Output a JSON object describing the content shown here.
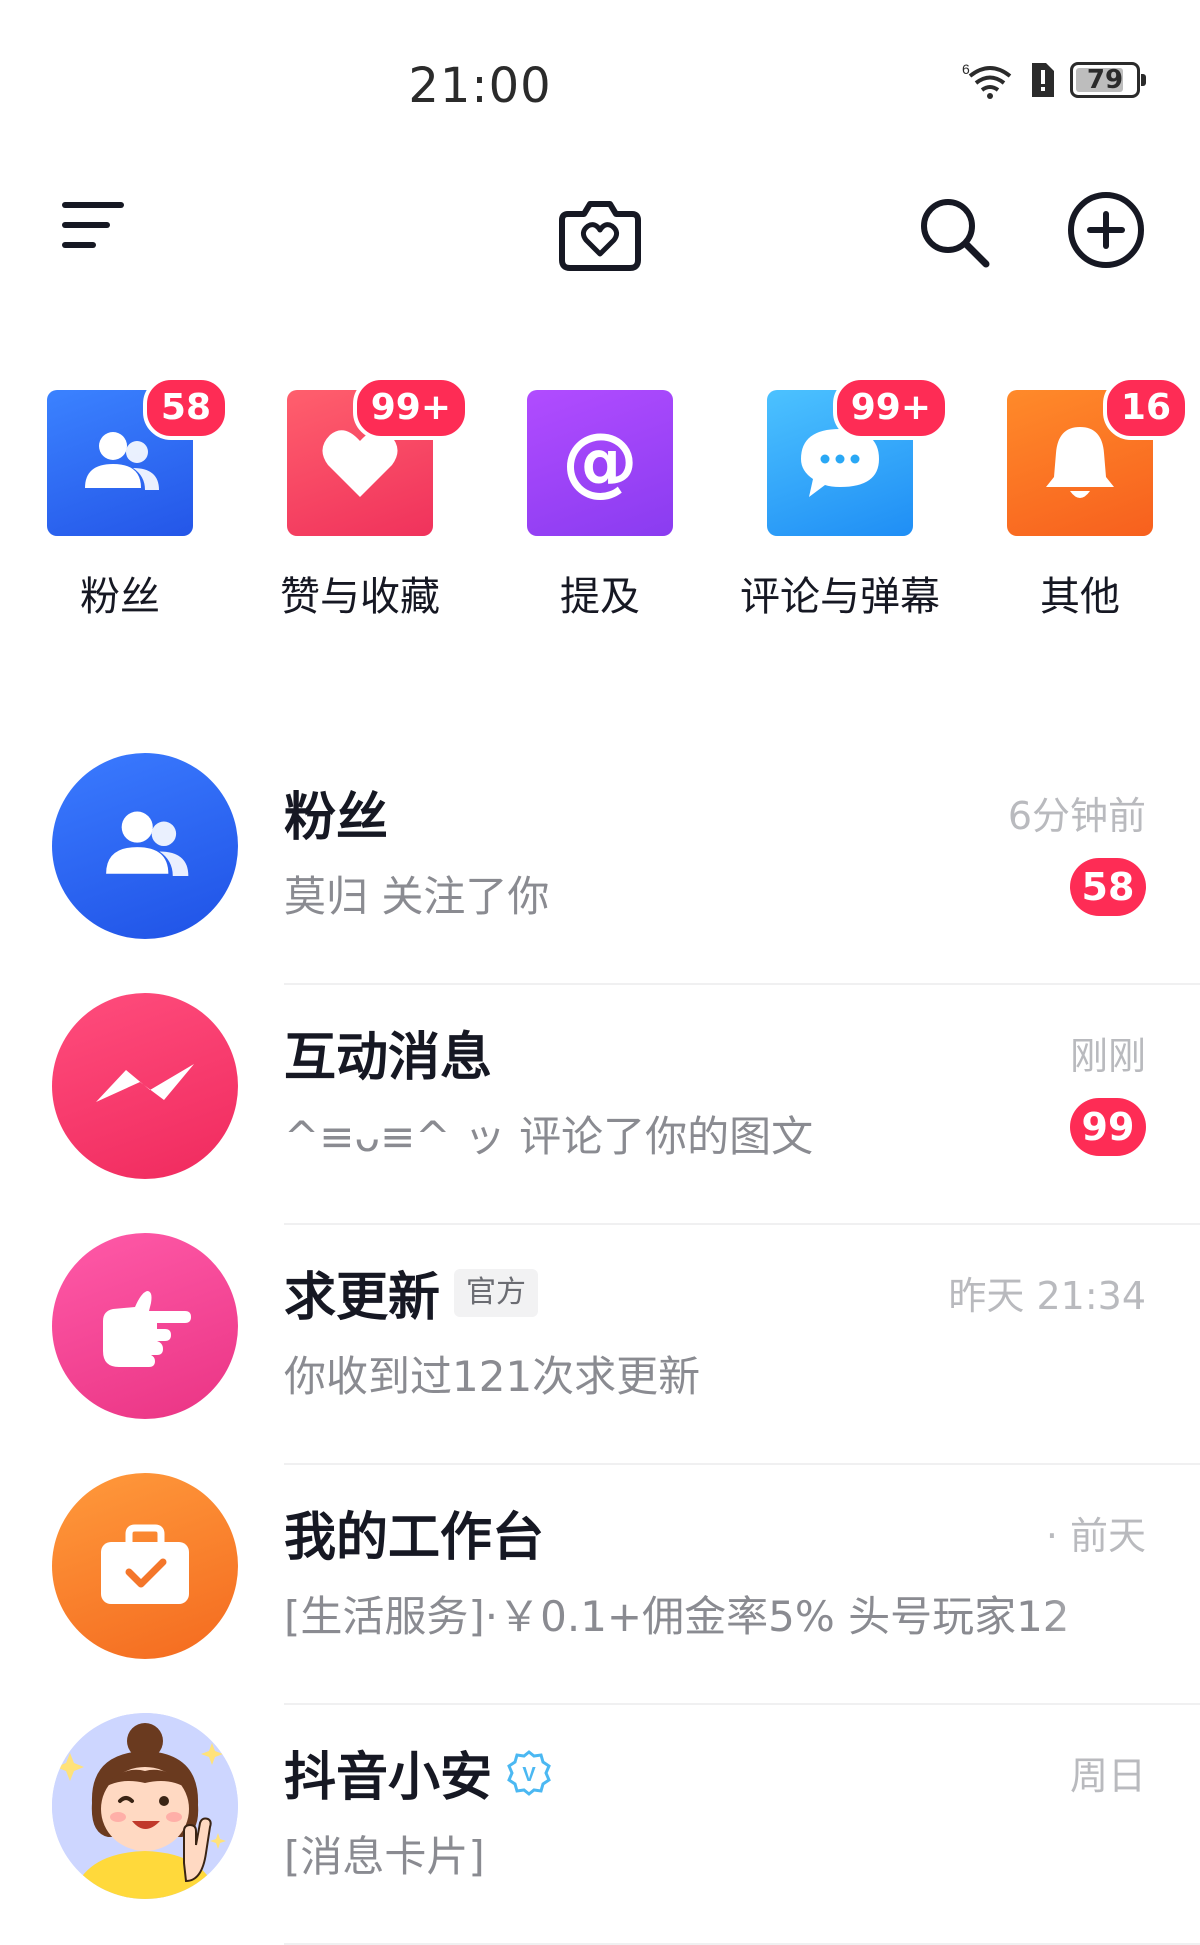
{
  "status_bar": {
    "time": "21:00",
    "battery": "79",
    "signal_label": "6"
  },
  "header": {
    "menu_icon": "menu-icon",
    "camera_icon": "heart-camera-icon",
    "search_icon": "search-icon",
    "add_icon": "add-circle-icon"
  },
  "quick_actions": [
    {
      "label": "粉丝",
      "badge": "58",
      "icon": "fans-icon",
      "color": "#2f6cf6"
    },
    {
      "label": "赞与收藏",
      "badge": "99+",
      "icon": "heart-icon",
      "color": "#f43f5e"
    },
    {
      "label": "提及",
      "badge": "",
      "icon": "at-icon",
      "color": "#a43ef0"
    },
    {
      "label": "评论与弹幕",
      "badge": "99+",
      "icon": "comment-icon",
      "color": "#2aa8f5"
    },
    {
      "label": "其他",
      "badge": "16",
      "icon": "bell-icon",
      "color": "#fb7a24"
    }
  ],
  "messages": [
    {
      "title": "粉丝",
      "tag": "",
      "verified": false,
      "subtitle": "莫归 关注了你",
      "time": "6分钟前",
      "count": "58",
      "icon": "fans-icon"
    },
    {
      "title": "互动消息",
      "tag": "",
      "verified": false,
      "subtitle": "^≡ᴗ≡^ ッ 评论了你的图文",
      "time": "刚刚",
      "count": "99",
      "icon": "lightning-icon"
    },
    {
      "title": "求更新",
      "tag": "官方",
      "verified": false,
      "subtitle": "你收到过121次求更新",
      "time": "昨天 21:34",
      "count": "",
      "icon": "pointing-hand-icon"
    },
    {
      "title": "我的工作台",
      "tag": "",
      "verified": false,
      "subtitle": "[生活服务]·￥0.1+佣金率5% 头号玩家12",
      "time": "· 前天",
      "count": "",
      "icon": "briefcase-icon"
    },
    {
      "title": "抖音小安",
      "tag": "",
      "verified": true,
      "subtitle": "[消息卡片]",
      "time": "周日",
      "count": "",
      "icon": "cartoon-girl-avatar"
    }
  ]
}
